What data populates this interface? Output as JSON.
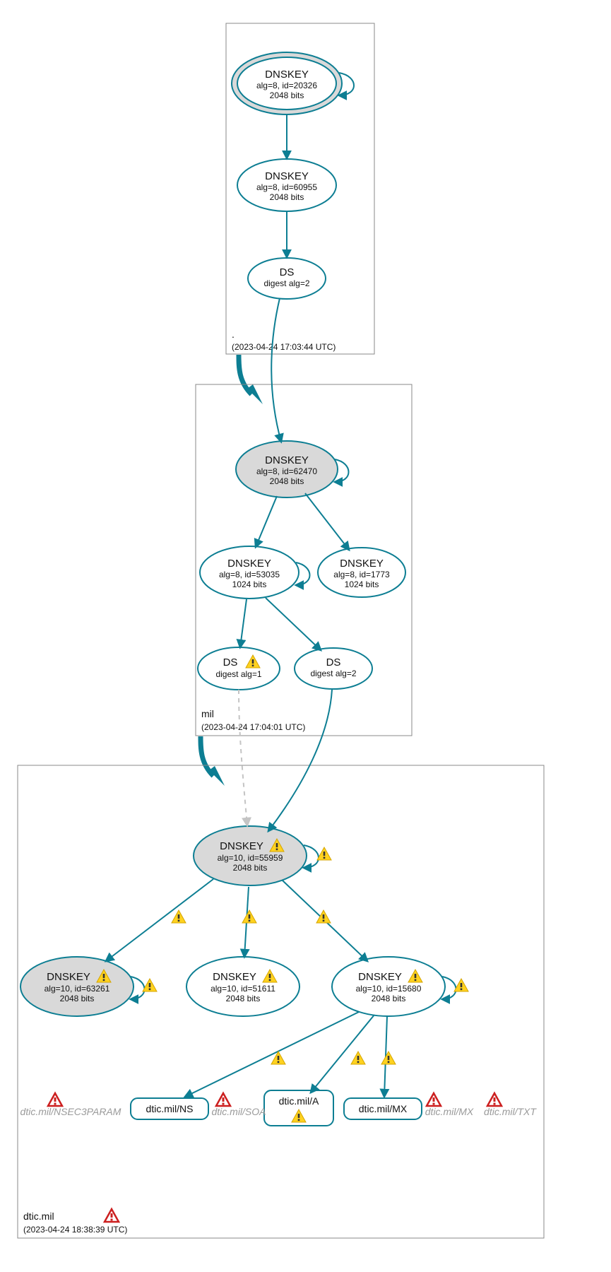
{
  "zones": {
    "root": {
      "label": ".",
      "timestamp": "(2023-04-24 17:03:44 UTC)",
      "nodes": {
        "ksk": {
          "title": "DNSKEY",
          "line1": "alg=8, id=20326",
          "line2": "2048 bits"
        },
        "zsk": {
          "title": "DNSKEY",
          "line1": "alg=8, id=60955",
          "line2": "2048 bits"
        },
        "ds": {
          "title": "DS",
          "line1": "digest alg=2"
        }
      }
    },
    "mil": {
      "label": "mil",
      "timestamp": "(2023-04-24 17:04:01 UTC)",
      "nodes": {
        "ksk": {
          "title": "DNSKEY",
          "line1": "alg=8, id=62470",
          "line2": "2048 bits"
        },
        "zsk1": {
          "title": "DNSKEY",
          "line1": "alg=8, id=53035",
          "line2": "1024 bits"
        },
        "zsk2": {
          "title": "DNSKEY",
          "line1": "alg=8, id=1773",
          "line2": "1024 bits"
        },
        "ds1": {
          "title": "DS",
          "line1": "digest alg=1",
          "warn": true
        },
        "ds2": {
          "title": "DS",
          "line1": "digest alg=2"
        }
      }
    },
    "dtic": {
      "label": "dtic.mil",
      "timestamp": "(2023-04-24 18:38:39 UTC)",
      "nodes": {
        "ksk": {
          "title": "DNSKEY",
          "line1": "alg=10, id=55959",
          "line2": "2048 bits",
          "warn": true
        },
        "k2": {
          "title": "DNSKEY",
          "line1": "alg=10, id=63261",
          "line2": "2048 bits",
          "warn": true
        },
        "k3": {
          "title": "DNSKEY",
          "line1": "alg=10, id=51611",
          "line2": "2048 bits",
          "warn": true
        },
        "k4": {
          "title": "DNSKEY",
          "line1": "alg=10, id=15680",
          "line2": "2048 bits",
          "warn": true
        }
      },
      "rrsets": {
        "ns": {
          "label": "dtic.mil/NS"
        },
        "a": {
          "label": "dtic.mil/A",
          "warn": true
        },
        "mx": {
          "label": "dtic.mil/MX"
        }
      },
      "grey_rrsets": {
        "nsec3": {
          "label": "dtic.mil/NSEC3PARAM"
        },
        "soa": {
          "label": "dtic.mil/SOA"
        },
        "mx2": {
          "label": "dtic.mil/MX"
        },
        "txt": {
          "label": "dtic.mil/TXT"
        }
      }
    }
  }
}
